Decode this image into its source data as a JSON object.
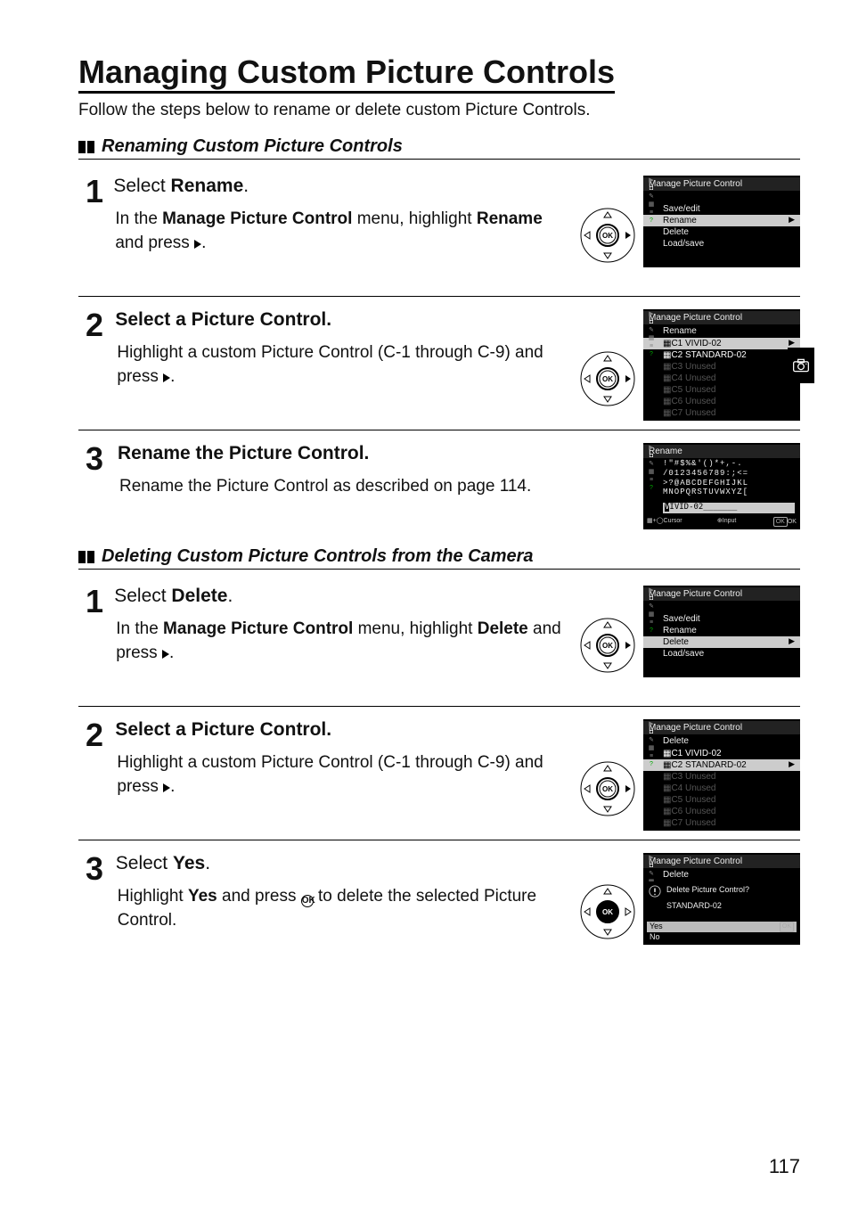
{
  "page": {
    "title": "Managing Custom Picture Controls",
    "intro": "Follow the steps below to rename or delete custom Picture Controls.",
    "number": "117"
  },
  "sectionA": {
    "heading": "Renaming Custom Picture Controls",
    "steps": [
      {
        "num": "1",
        "head_pre": "Select ",
        "head_strong": "Rename",
        "head_post": ".",
        "body_pre": "In the ",
        "body_strong1": "Manage Picture Control",
        "body_mid": " menu, highlight ",
        "body_strong2": "Rename",
        "body_post": " and press "
      },
      {
        "num": "2",
        "head_pre": "Select a Picture Control.",
        "body_pre": "Highlight a custom Picture Control (C-1 through C-9) and press "
      },
      {
        "num": "3",
        "head_pre": "Rename the Picture Control.",
        "body_pre": "Rename the Picture Control as described on page 114."
      }
    ],
    "lcd1": {
      "title": "Manage Picture Control",
      "items": [
        "Save/edit",
        "Rename",
        "Delete",
        "Load/save"
      ],
      "selected": "Rename"
    },
    "lcd2": {
      "title": "Manage Picture Control",
      "subtitle": "Rename",
      "items": [
        "C1 VIVID-02",
        "C2 STANDARD-02",
        "C3 Unused",
        "C4 Unused",
        "C5 Unused",
        "C6 Unused",
        "C7 Unused"
      ],
      "selected": "C1 VIVID-02"
    },
    "lcd3": {
      "title": "Rename",
      "chars1": "!\"#$%&'()*+,-.",
      "chars2": "/0123456789:;<=",
      "chars3": ">?@ABCDEFGHIJKL",
      "chars4": "MNOPQRSTUVWXYZ[",
      "input": "VIVID-02",
      "footer_left": "Cursor",
      "footer_mid": "Input",
      "footer_right": "OK"
    }
  },
  "sectionB": {
    "heading": "Deleting Custom Picture Controls from the Camera",
    "steps": [
      {
        "num": "1",
        "head_pre": "Select ",
        "head_strong": "Delete",
        "head_post": ".",
        "body_pre": "In the ",
        "body_strong1": "Manage Picture Control",
        "body_mid": " menu, highlight ",
        "body_strong2": "Delete",
        "body_post": " and press "
      },
      {
        "num": "2",
        "head_pre": "Select a Picture Control.",
        "body_pre": "Highlight a custom Picture Control (C-1 through C-9) and press "
      },
      {
        "num": "3",
        "head_pre": "Select ",
        "head_strong": "Yes",
        "head_post": ".",
        "body_pre": "Highlight ",
        "body_strong1": "Yes",
        "body_mid": " and press ",
        "body_post2": " to delete the selected Picture Control."
      }
    ],
    "lcd1": {
      "title": "Manage Picture Control",
      "items": [
        "Save/edit",
        "Rename",
        "Delete",
        "Load/save"
      ],
      "selected": "Delete"
    },
    "lcd2": {
      "title": "Manage Picture Control",
      "subtitle": "Delete",
      "items": [
        "C1 VIVID-02",
        "C2 STANDARD-02",
        "C3 Unused",
        "C4 Unused",
        "C5 Unused",
        "C6 Unused",
        "C7 Unused"
      ],
      "selected": "C2 STANDARD-02"
    },
    "lcd3": {
      "title": "Manage Picture Control",
      "subtitle": "Delete",
      "question": "Delete Picture Control?",
      "target": "STANDARD-02",
      "yes": "Yes",
      "no": "No",
      "ok": "OK"
    }
  }
}
